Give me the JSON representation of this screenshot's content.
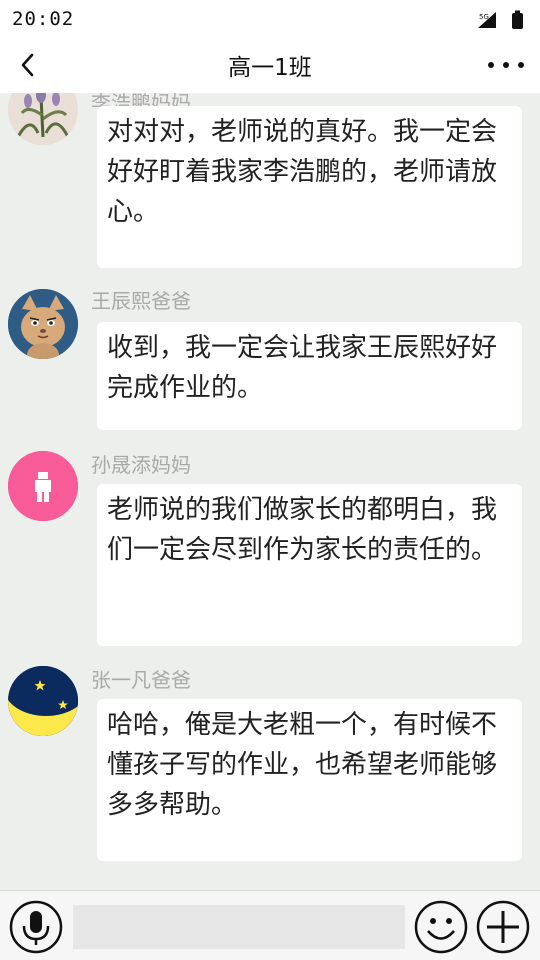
{
  "status": {
    "time": "20:02",
    "network": "5G"
  },
  "header": {
    "title": "高一1班"
  },
  "messages": [
    {
      "sender": "李浩鹏妈妈",
      "avatar": "plant-painting-avatar",
      "text": "对对对，老师说的真好。我一定会好好盯着我家李浩鹏的，老师请放心。"
    },
    {
      "sender": "王辰熙爸爸",
      "avatar": "cartoon-cat-avatar",
      "text": "收到，我一定会让我家王辰熙好好完成作业的。"
    },
    {
      "sender": "孙晟添妈妈",
      "avatar": "person-icon-avatar",
      "text": "老师说的我们做家长的都明白，我们一定会尽到作为家长的责任的。"
    },
    {
      "sender": "张一凡爸爸",
      "avatar": "moon-stars-avatar",
      "text": "哈哈，俺是大老粗一个，有时候不懂孩子写的作业，也希望老师能够多多帮助。"
    }
  ],
  "input_bar": {
    "text_value": "",
    "placeholder": ""
  },
  "colors": {
    "chat_background": "#edefec",
    "bubble": "#ffffff",
    "sender_name": "#a9a9a9",
    "person_avatar": "#f75b98",
    "moon_avatar_sky": "#0b2a5e",
    "moon_avatar_moon": "#fde84a",
    "cat_avatar_bg": "#2f5c85"
  }
}
